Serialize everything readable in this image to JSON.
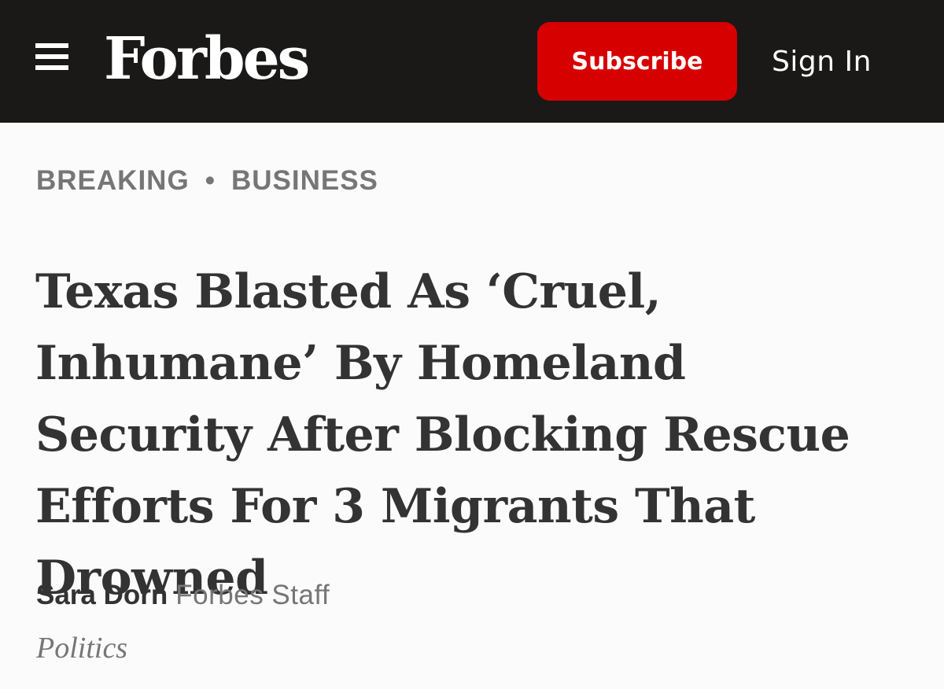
{
  "header": {
    "logo_text": "Forbes",
    "subscribe_label": "Subscribe",
    "signin_label": "Sign In",
    "menu_icon": "hamburger-menu-icon"
  },
  "breadcrumb": {
    "section1": "BREAKING",
    "separator": "•",
    "section2": "BUSINESS"
  },
  "article": {
    "headline": "Texas Blasted As ‘Cruel, Inhumane’ By Homeland Security After Blocking Rescue Efforts For 3 Migrants That Drowned",
    "author_name": "Sara Dorn",
    "author_role": "Forbes Staff",
    "channel": "Politics"
  },
  "colors": {
    "header_bg": "#1a1918",
    "subscribe_bg": "#d60000",
    "text_dark": "#333333",
    "text_gray": "#767676",
    "page_bg": "#fbfbfb"
  }
}
